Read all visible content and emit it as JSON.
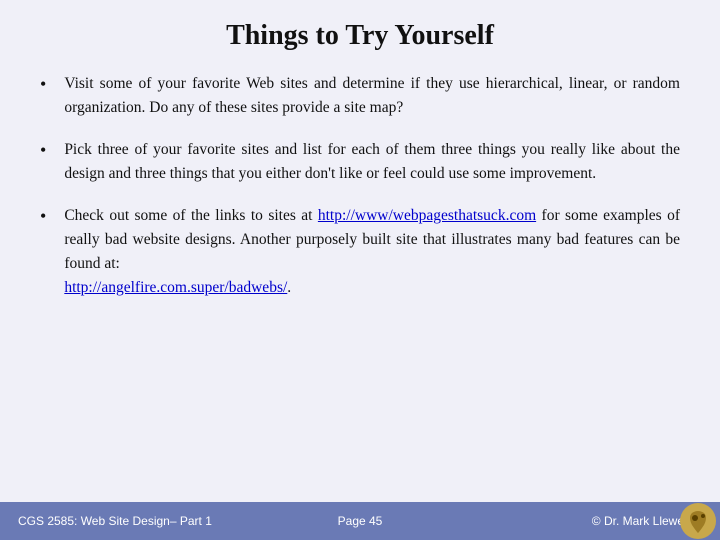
{
  "title": "Things to Try Yourself",
  "bullets": [
    {
      "id": 1,
      "text": "Visit some of your favorite Web sites and determine if they use hierarchical, linear, or random organization.  Do any of these sites provide a site map?"
    },
    {
      "id": 2,
      "text": "Pick three of your favorite sites and list for each of them three things you really like about the design and three things that you either don't like or feel could use some improvement."
    },
    {
      "id": 3,
      "text_before": "Check  out  some  of  the  links  to  sites  at ",
      "link1": "http://www/webpagesthatsuck.com",
      "text_middle": "  for  some  examples  of really bad website designs.  Another purposely built site that illustrates  many  bad  features  can  be  found  at:",
      "link2": "http://angelfire.com.super/badwebs/",
      "text_after": "."
    }
  ],
  "footer": {
    "left": "CGS 2585: Web Site Design– Part 1",
    "center": "Page 45",
    "right": "© Dr. Mark Llewellyn"
  }
}
